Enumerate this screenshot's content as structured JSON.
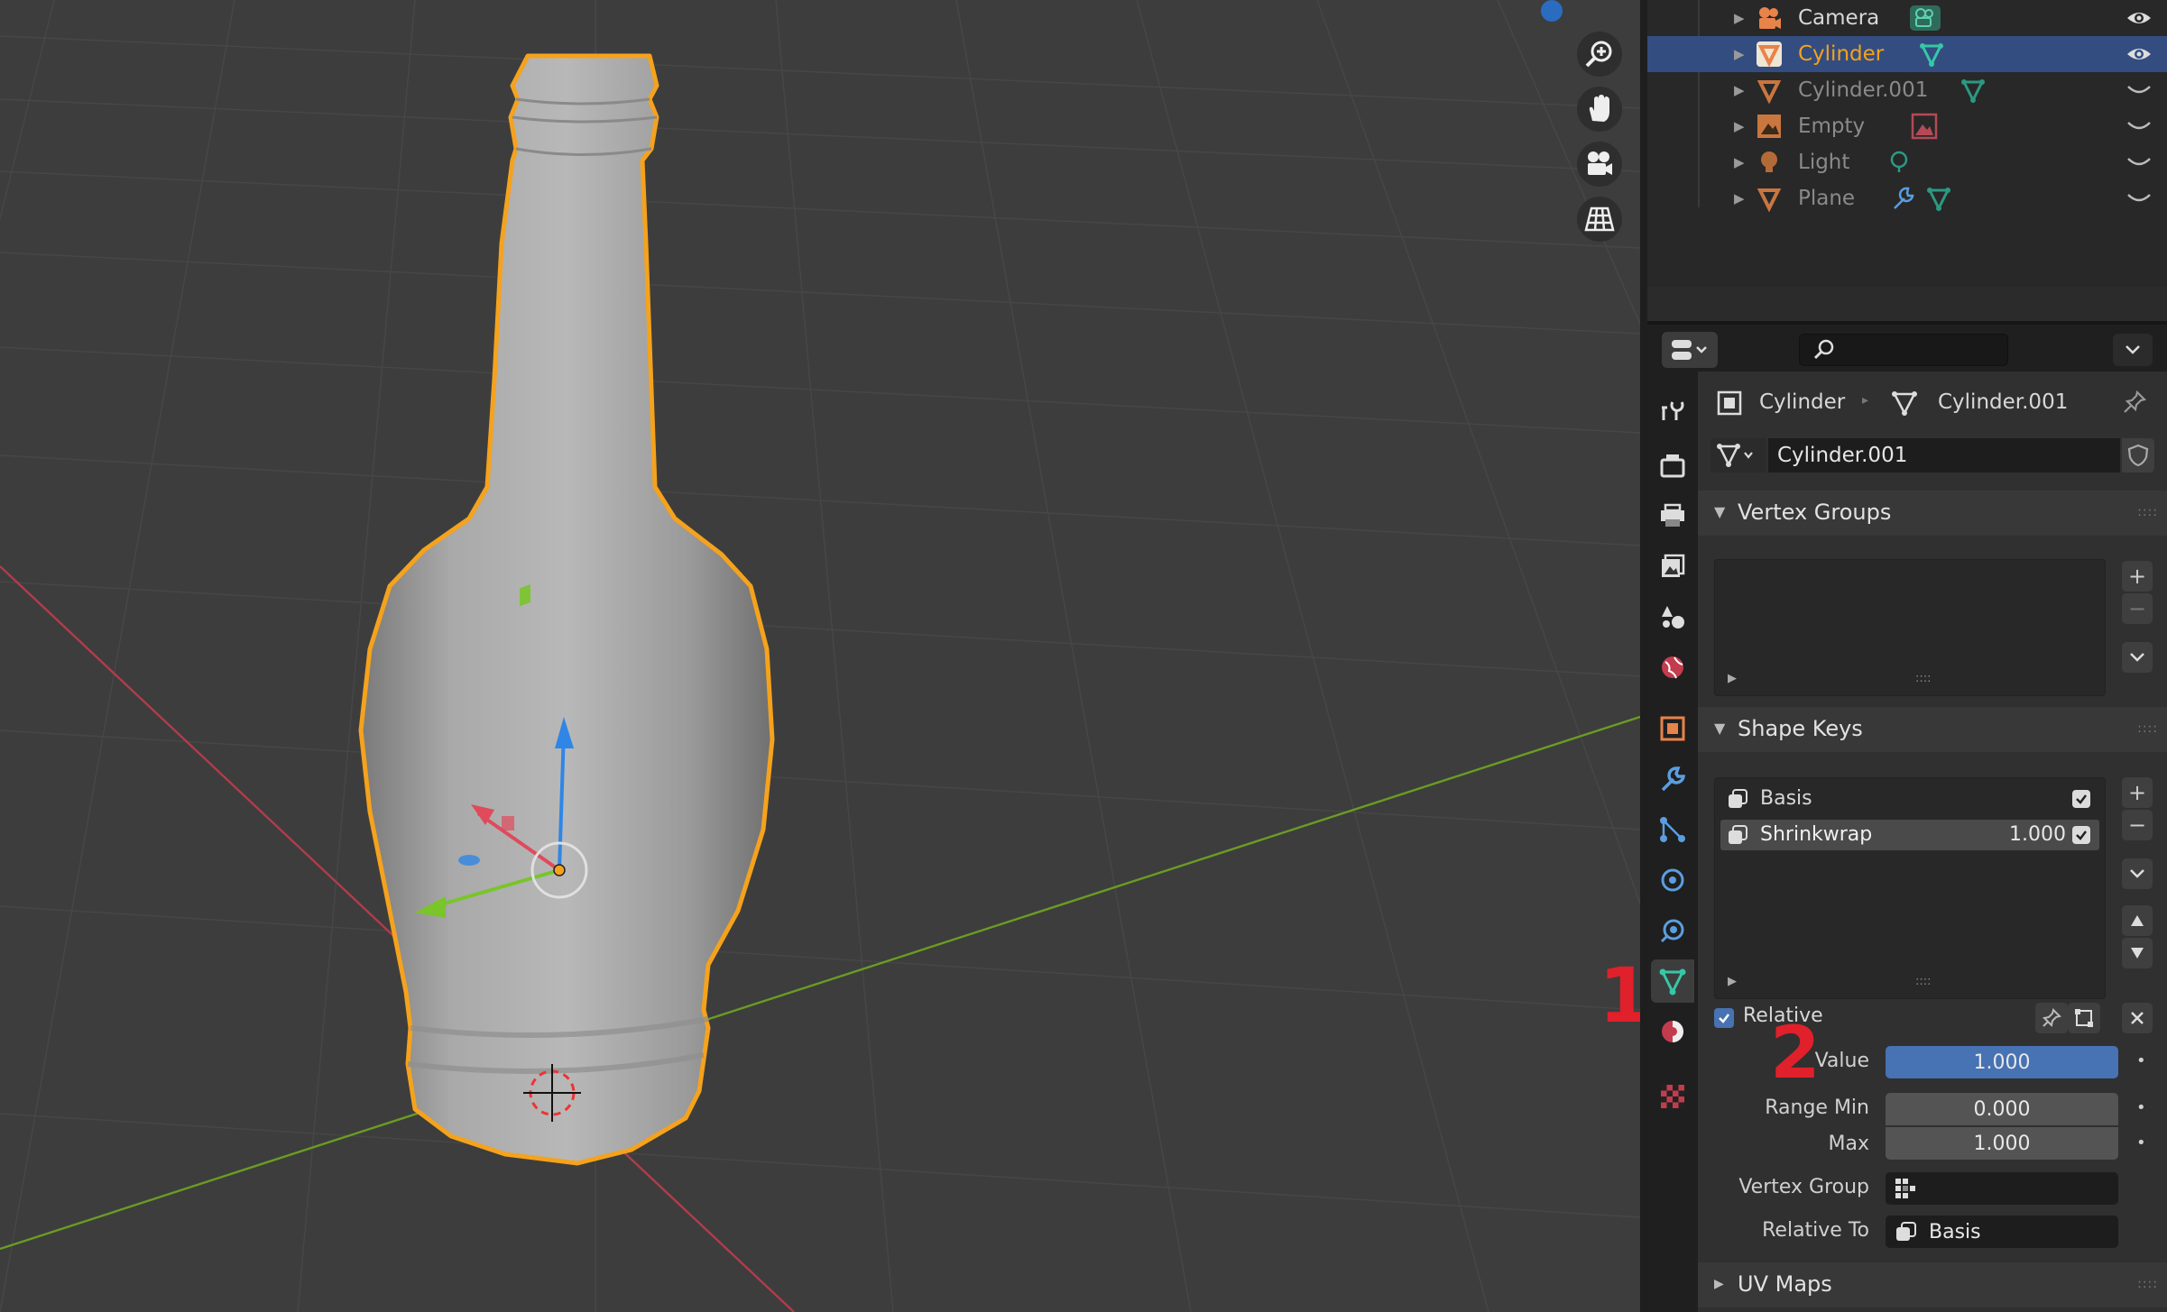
{
  "outliner": {
    "items": [
      {
        "name": "Camera",
        "icon": "camera-object-icon",
        "selected": false,
        "visible": true
      },
      {
        "name": "Cylinder",
        "icon": "mesh-object-icon",
        "selected": true,
        "visible": true
      },
      {
        "name": "Cylinder.001",
        "icon": "mesh-object-icon",
        "selected": false,
        "visible": false
      },
      {
        "name": "Empty",
        "icon": "empty-object-icon",
        "selected": false,
        "visible": false
      },
      {
        "name": "Light",
        "icon": "light-object-icon",
        "selected": false,
        "visible": false
      },
      {
        "name": "Plane",
        "icon": "mesh-object-icon",
        "selected": false,
        "visible": false
      }
    ]
  },
  "properties": {
    "search": {
      "value": "",
      "placeholder": ""
    },
    "breadcrumb": {
      "object": "Cylinder",
      "data": "Cylinder.001"
    },
    "datablock": {
      "name": "Cylinder.001"
    },
    "vertex_groups": {
      "title": "Vertex Groups"
    },
    "shape_keys": {
      "title": "Shape Keys",
      "items": [
        {
          "name": "Basis",
          "value": "",
          "enabled": true
        },
        {
          "name": "Shrinkwrap",
          "value": "1.000",
          "enabled": true
        }
      ],
      "relative_label": "Relative",
      "relative_checked": true,
      "value_label": "Value",
      "value": "1.000",
      "value_fraction": 1.0,
      "range_min_label": "Range Min",
      "range_min": "0.000",
      "max_label": "Max",
      "max": "1.000",
      "vertex_group_label": "Vertex Group",
      "vertex_group": "",
      "relative_to_label": "Relative To",
      "relative_to": "Basis"
    },
    "uv_maps": {
      "title": "UV Maps"
    }
  },
  "annotations": {
    "one": "1",
    "two": "2"
  },
  "colors": {
    "selection_orange": "#f5a21c",
    "selected_row": "#334d80",
    "accent_blue": "#4772b3",
    "annotation_red": "#e0202a",
    "axis_x": "#d1384a",
    "axis_y": "#6cb021"
  }
}
